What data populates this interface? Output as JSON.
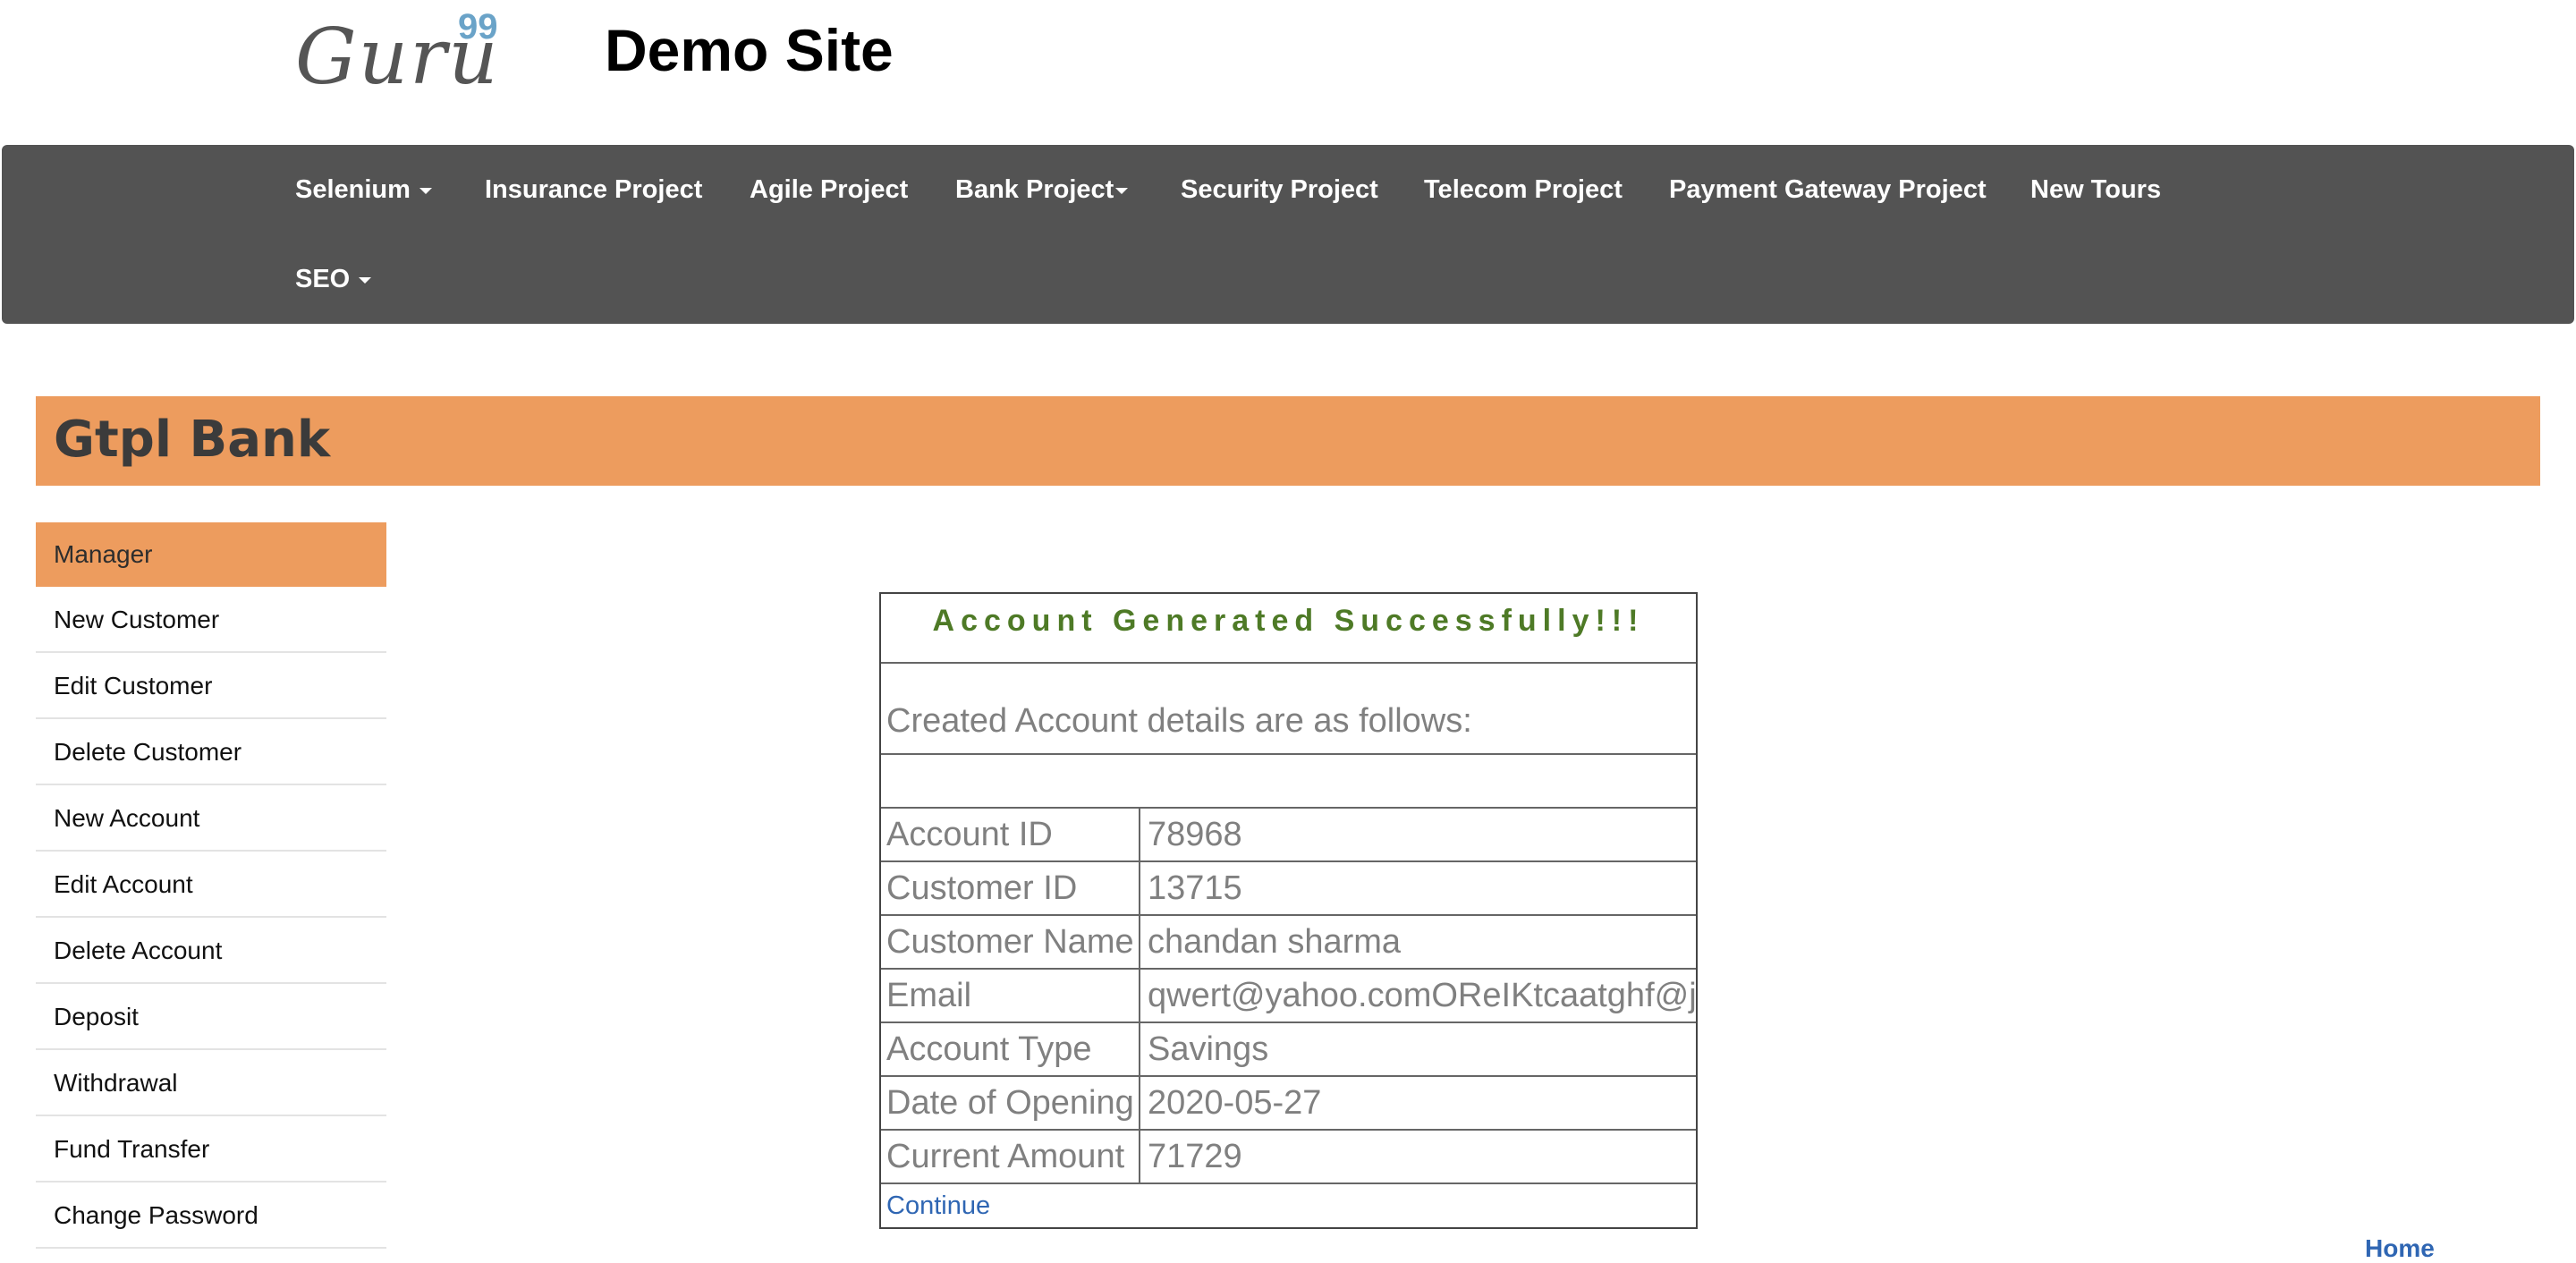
{
  "header": {
    "logo_text": "Guru",
    "logo_superscript": "99",
    "site_title": "Demo Site"
  },
  "nav": {
    "items": [
      {
        "label": "Selenium",
        "has_dropdown": true
      },
      {
        "label": "Insurance Project",
        "has_dropdown": false
      },
      {
        "label": "Agile Project",
        "has_dropdown": false
      },
      {
        "label": "Bank Project",
        "has_dropdown": true
      },
      {
        "label": "Security Project",
        "has_dropdown": false
      },
      {
        "label": "Telecom Project",
        "has_dropdown": false
      },
      {
        "label": "Payment Gateway Project",
        "has_dropdown": false
      },
      {
        "label": "New Tours",
        "has_dropdown": false
      },
      {
        "label": "SEO",
        "has_dropdown": true
      }
    ]
  },
  "banner": {
    "title": "Gtpl Bank"
  },
  "sidebar": {
    "header": "Manager",
    "items": [
      {
        "label": "New Customer"
      },
      {
        "label": "Edit Customer"
      },
      {
        "label": "Delete Customer"
      },
      {
        "label": "New Account"
      },
      {
        "label": "Edit Account"
      },
      {
        "label": "Delete Account"
      },
      {
        "label": "Deposit"
      },
      {
        "label": "Withdrawal"
      },
      {
        "label": "Fund Transfer"
      },
      {
        "label": "Change Password"
      }
    ]
  },
  "result": {
    "heading": "Account Generated Successfully!!!",
    "subheading": "Created Account details are as follows:",
    "rows": [
      {
        "label": "Account ID",
        "value": "78968"
      },
      {
        "label": "Customer ID",
        "value": "13715"
      },
      {
        "label": "Customer Name",
        "value": "chandan sharma"
      },
      {
        "label": "Email",
        "value": "qwert@yahoo.comOReIKtcaatghf@j"
      },
      {
        "label": "Account Type",
        "value": "Savings"
      },
      {
        "label": "Date of Opening",
        "value": "2020-05-27"
      },
      {
        "label": "Current Amount",
        "value": "71729"
      }
    ],
    "continue_label": "Continue"
  },
  "footer": {
    "home_label": "Home"
  },
  "colors": {
    "navbar_bg": "#535353",
    "accent_orange": "#ed9c5e",
    "success_green": "#4e7a26",
    "link_blue": "#2f66b3"
  }
}
